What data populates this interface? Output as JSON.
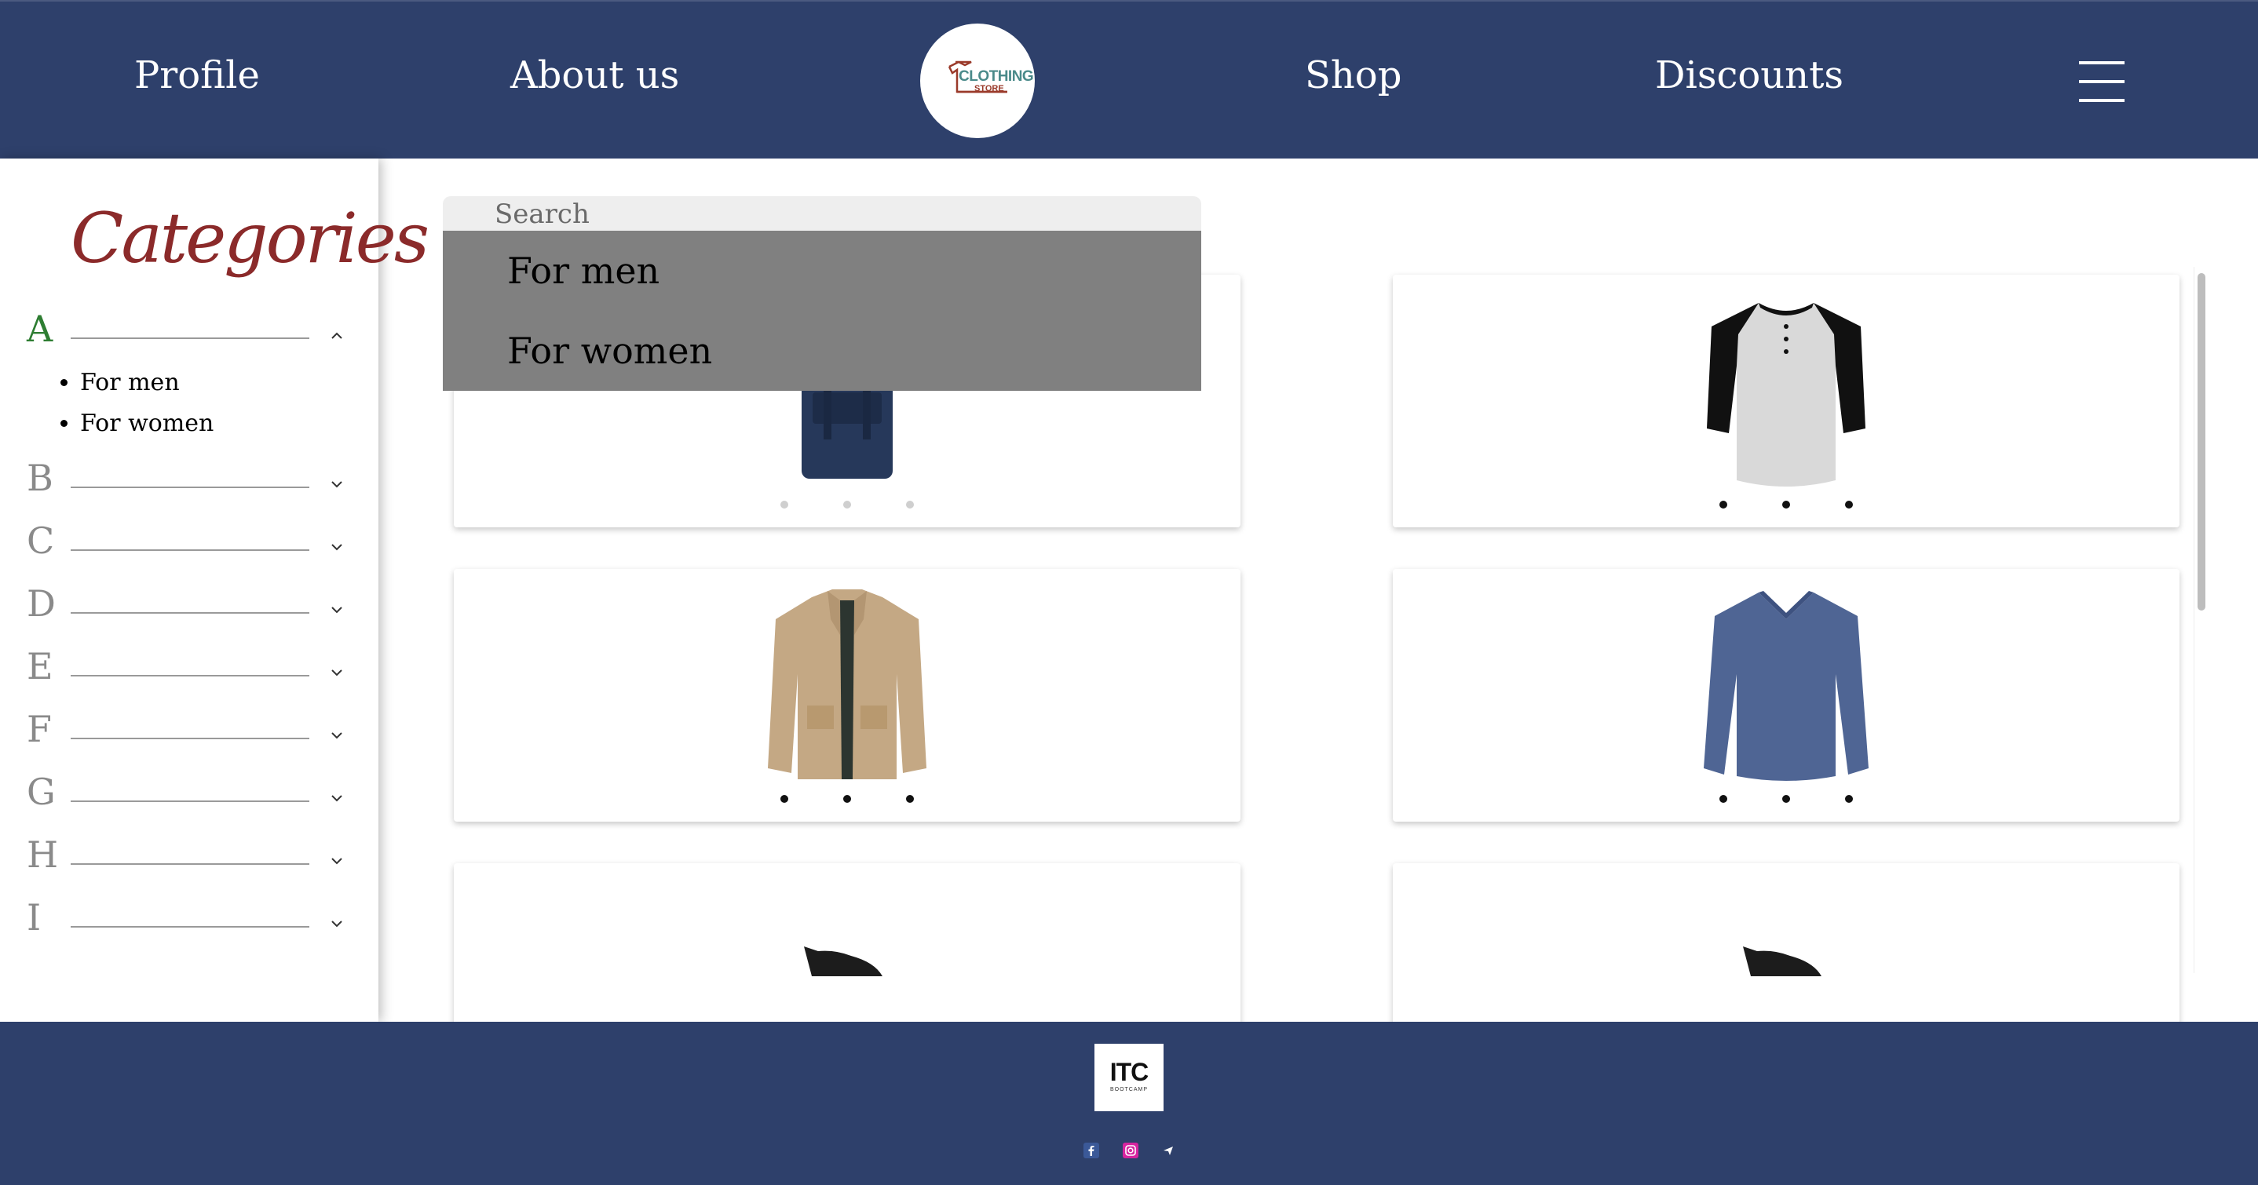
{
  "header": {
    "nav": [
      {
        "label": "Profile"
      },
      {
        "label": "About us"
      },
      {
        "label": "Shop"
      },
      {
        "label": "Discounts"
      }
    ],
    "logo": {
      "line1": "CLOTHING",
      "line2": "STORE"
    }
  },
  "sidebar": {
    "title": "Categories",
    "letters": [
      "A",
      "B",
      "C",
      "D",
      "E",
      "F",
      "G",
      "H",
      "I"
    ],
    "expanded_letter": "A",
    "sub_items": [
      "For men",
      "For women"
    ]
  },
  "search": {
    "placeholder": "Search",
    "suggestions": [
      "For men",
      "For women"
    ]
  },
  "products": [
    {
      "item": "bag-icon"
    },
    {
      "item": "henley-shirt-icon"
    },
    {
      "item": "jacket-icon"
    },
    {
      "item": "sweater-icon"
    },
    {
      "item": "shoe-icon"
    },
    {
      "item": "shoe-icon"
    }
  ],
  "footer": {
    "logo_main": "ITC",
    "logo_sub": "BOOTCAMP",
    "social": [
      "facebook-icon",
      "instagram-icon",
      "telegram-icon"
    ]
  },
  "colors": {
    "header_bg": "#2e406b",
    "title_red": "#8b2a2a",
    "active_green": "#2e7d32",
    "dropdown_gray": "#808080"
  }
}
